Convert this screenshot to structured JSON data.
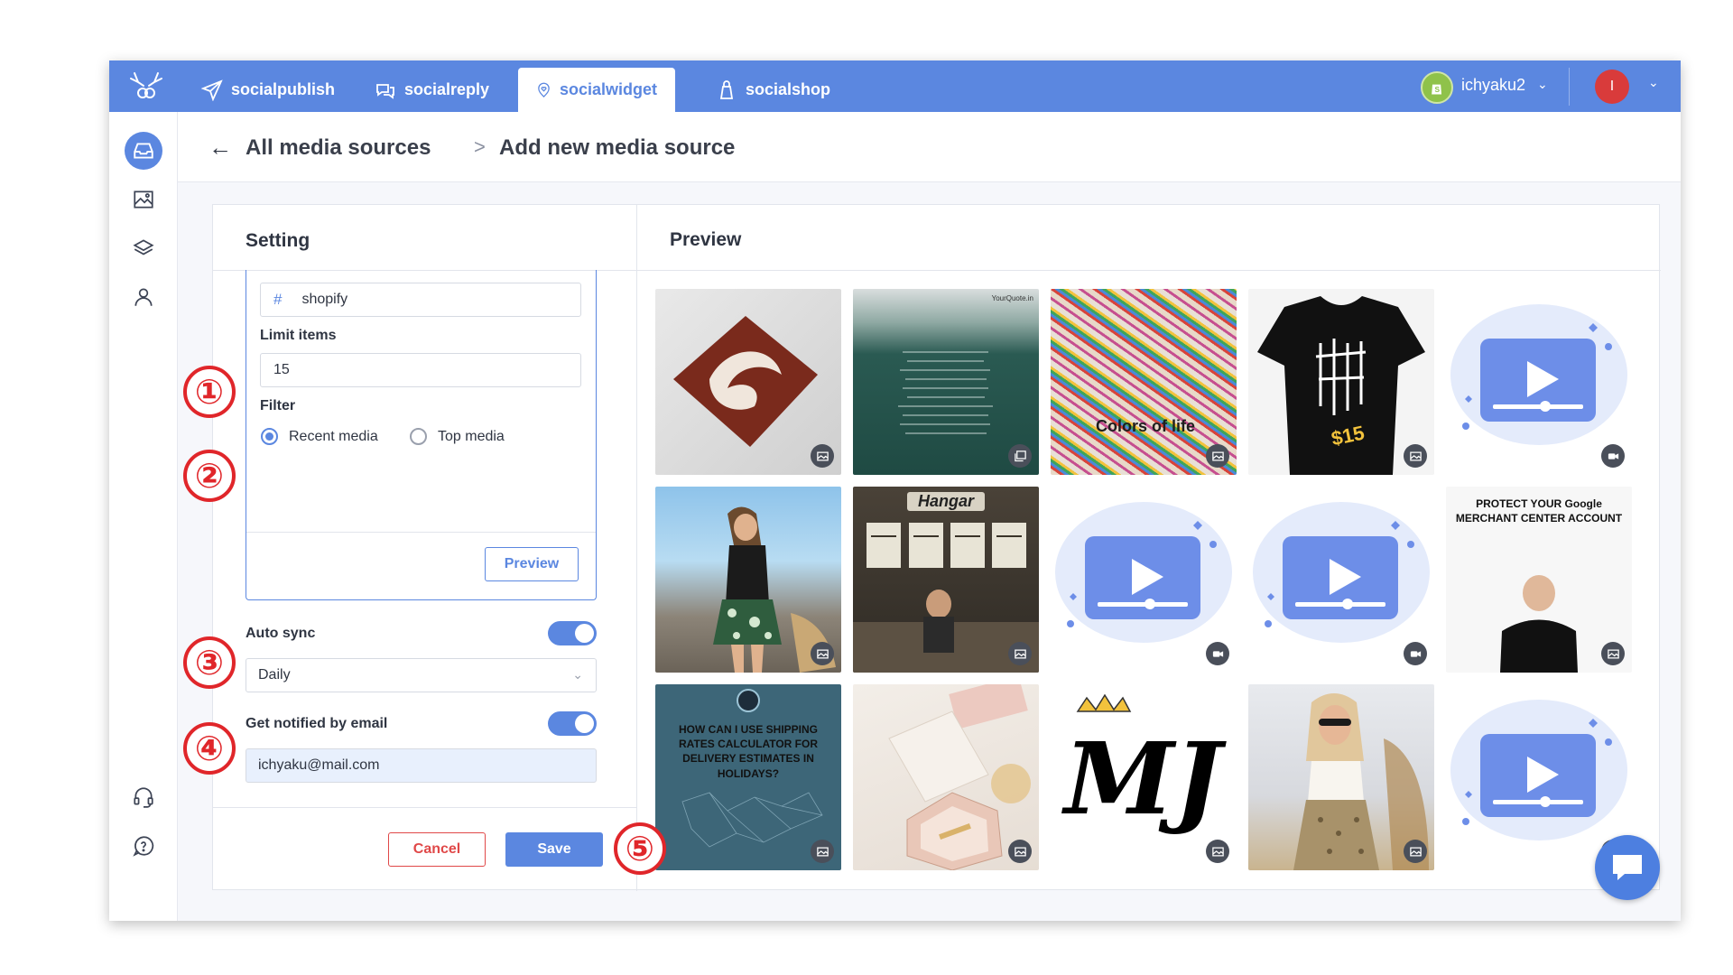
{
  "topbar": {
    "tabs": [
      {
        "label": "socialpublish",
        "icon": "paper-plane-icon"
      },
      {
        "label": "socialreply",
        "icon": "chat-bubbles-icon"
      },
      {
        "label": "socialwidget",
        "icon": "heart-pin-icon"
      },
      {
        "label": "socialshop",
        "icon": "shopping-bag-icon"
      }
    ],
    "active_tab": "socialwidget",
    "shop_name": "ichyaku2",
    "user_initial": "I"
  },
  "header": {
    "back_label": "←",
    "crumb_parent": "All media sources",
    "crumb_separator": ">",
    "crumb_current": "Add new media source"
  },
  "setting": {
    "title": "Setting",
    "hashtag_symbol": "#",
    "hashtag_value": "shopify",
    "limit_label": "Limit items",
    "limit_value": "15",
    "filter_label": "Filter",
    "filter_options": [
      "Recent media",
      "Top media"
    ],
    "filter_selected": "Recent media",
    "preview_button": "Preview",
    "auto_sync_label": "Auto sync",
    "auto_sync_on": true,
    "sync_frequency": "Daily",
    "notify_label": "Get notified by email",
    "notify_on": true,
    "email_value": "ichyaku@mail.com",
    "cancel_button": "Cancel",
    "save_button": "Save"
  },
  "preview": {
    "title": "Preview",
    "items": [
      {
        "type": "image",
        "desc": "pillow"
      },
      {
        "type": "image",
        "desc": "ocean-quote",
        "text": "YourQuote.in"
      },
      {
        "type": "image",
        "desc": "paint-splatter",
        "text": "Colors of life"
      },
      {
        "type": "image",
        "desc": "tshirt",
        "text": "$15"
      },
      {
        "type": "video",
        "desc": "video-placeholder"
      },
      {
        "type": "image",
        "desc": "beach-woman"
      },
      {
        "type": "image",
        "desc": "cafe",
        "text": "Hangar"
      },
      {
        "type": "video",
        "desc": "video-placeholder"
      },
      {
        "type": "video",
        "desc": "video-placeholder"
      },
      {
        "type": "image",
        "desc": "google-merchant",
        "text": "PROTECT YOUR Google MERCHANT CENTER ACCOUNT"
      },
      {
        "type": "image",
        "desc": "shipping-map",
        "text": "HOW CAN I USE SHIPPING RATES CALCULATOR FOR DELIVERY ESTIMATES IN HOLIDAYS?"
      },
      {
        "type": "image",
        "desc": "jewelry-box"
      },
      {
        "type": "image",
        "desc": "mj-logo",
        "text": "MJ"
      },
      {
        "type": "image",
        "desc": "woman-fashion"
      },
      {
        "type": "video",
        "desc": "video-placeholder"
      }
    ]
  },
  "annotations": [
    "①",
    "②",
    "③",
    "④",
    "⑤"
  ],
  "colors": {
    "brand": "#5b87e0",
    "danger": "#e04848",
    "annotation": "#e0262a"
  }
}
